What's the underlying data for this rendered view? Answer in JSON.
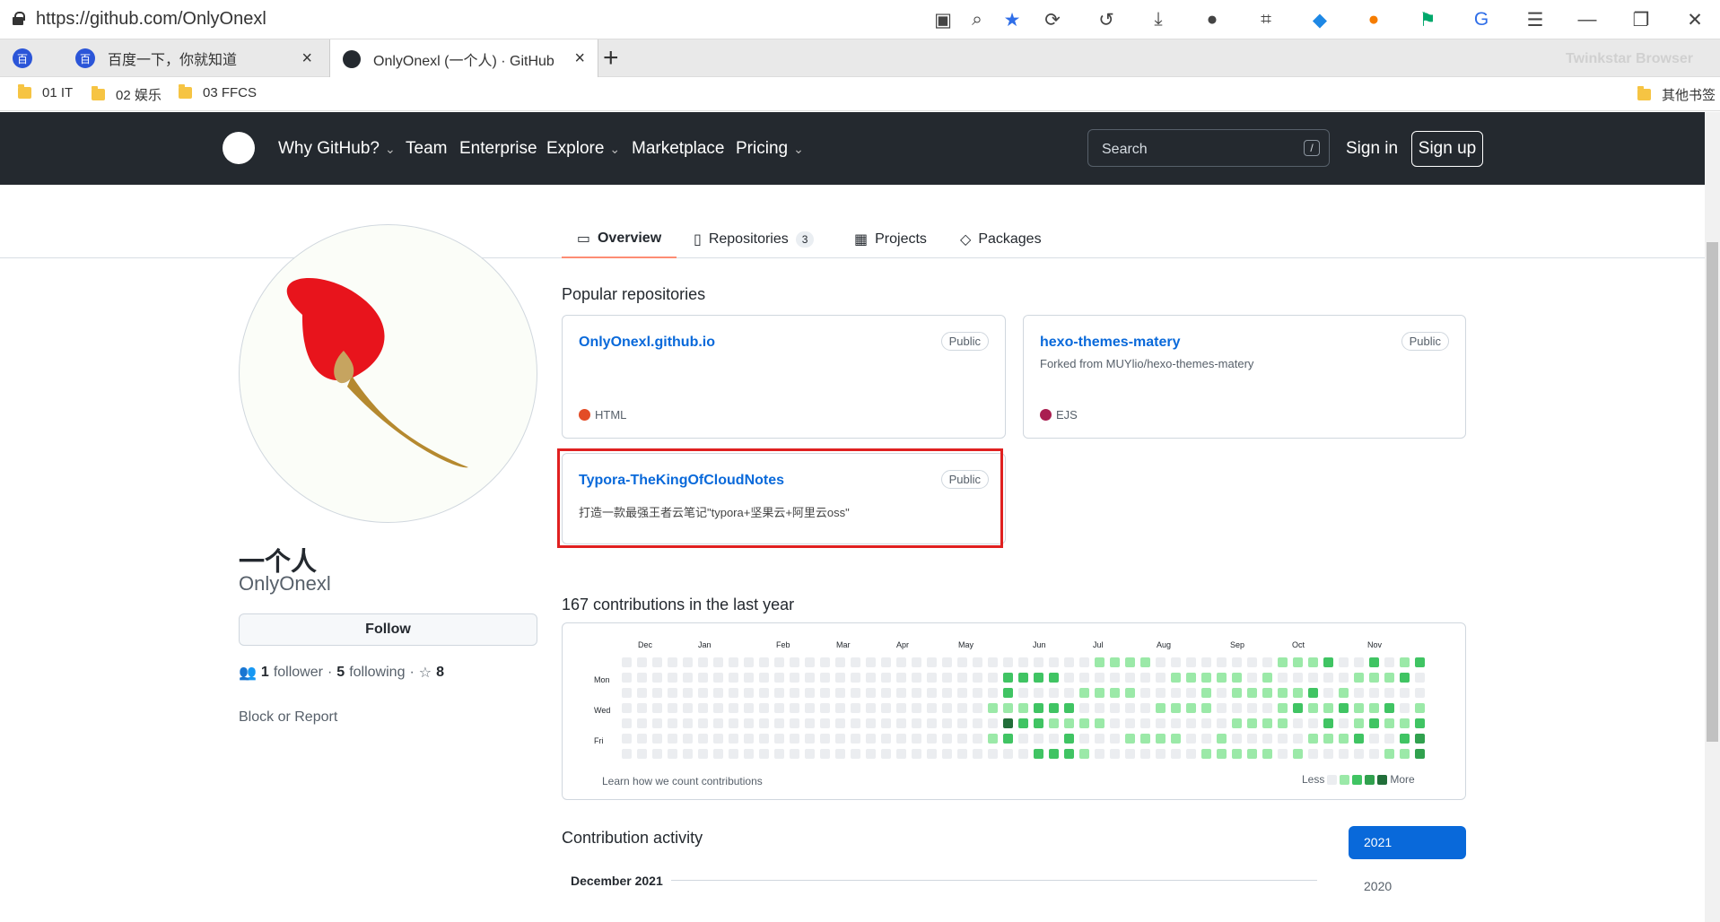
{
  "browser": {
    "url": "https://github.com/OnlyOnexl",
    "tabs": [
      {
        "label": ""
      },
      {
        "label": "百度一下，你就知道"
      },
      {
        "label": "OnlyOnexl (一个人) · GitHub"
      }
    ],
    "watermark": "Twinkstar Browser",
    "bookmarks": [
      "01 IT",
      "02 娱乐",
      "03 FFCS"
    ],
    "other_bookmarks": "其他书签"
  },
  "github_nav": {
    "items": [
      "Why GitHub?",
      "Team",
      "Enterprise",
      "Explore",
      "Marketplace",
      "Pricing"
    ],
    "search_placeholder": "Search",
    "slash": "/",
    "sign_in": "Sign in",
    "sign_up": "Sign up"
  },
  "profile_tabs": [
    {
      "label": "Overview"
    },
    {
      "label": "Repositories",
      "count": "3"
    },
    {
      "label": "Projects"
    },
    {
      "label": "Packages"
    }
  ],
  "profile": {
    "name": "一个人",
    "login": "OnlyOnexl",
    "follow": "Follow",
    "followers": "1",
    "followers_label": "follower",
    "following": "5",
    "following_label": "following",
    "stars": "8",
    "block": "Block or Report"
  },
  "popular": {
    "title": "Popular repositories",
    "repos": [
      {
        "name": "OnlyOnexl.github.io",
        "visibility": "Public",
        "desc": "",
        "language": "HTML",
        "language_color": "#e34c26"
      },
      {
        "name": "hexo-themes-matery",
        "visibility": "Public",
        "desc": "Forked from MUYlio/hexo-themes-matery",
        "language": "EJS",
        "language_color": "#a91e50"
      },
      {
        "name": "Typora-TheKingOfCloudNotes",
        "visibility": "Public",
        "desc": "打造一款最强王者云笔记\"typora+坚果云+阿里云oss\"",
        "language": "",
        "language_color": ""
      }
    ]
  },
  "contributions": {
    "title": "167 contributions in the last year",
    "months": [
      "Dec",
      "Jan",
      "Feb",
      "Mar",
      "Apr",
      "May",
      "Jun",
      "Jul",
      "Aug",
      "Sep",
      "Oct",
      "Nov"
    ],
    "days": [
      "Mon",
      "Wed",
      "Fri"
    ],
    "learn": "Learn how we count contributions",
    "less": "Less",
    "more": "More",
    "colors": [
      "#ebedf0",
      "#9be9a8",
      "#40c463",
      "#30a14e",
      "#216e39"
    ]
  },
  "activity": {
    "title": "Contribution activity",
    "month": "December 2021",
    "years": [
      "2021",
      "2020"
    ]
  }
}
